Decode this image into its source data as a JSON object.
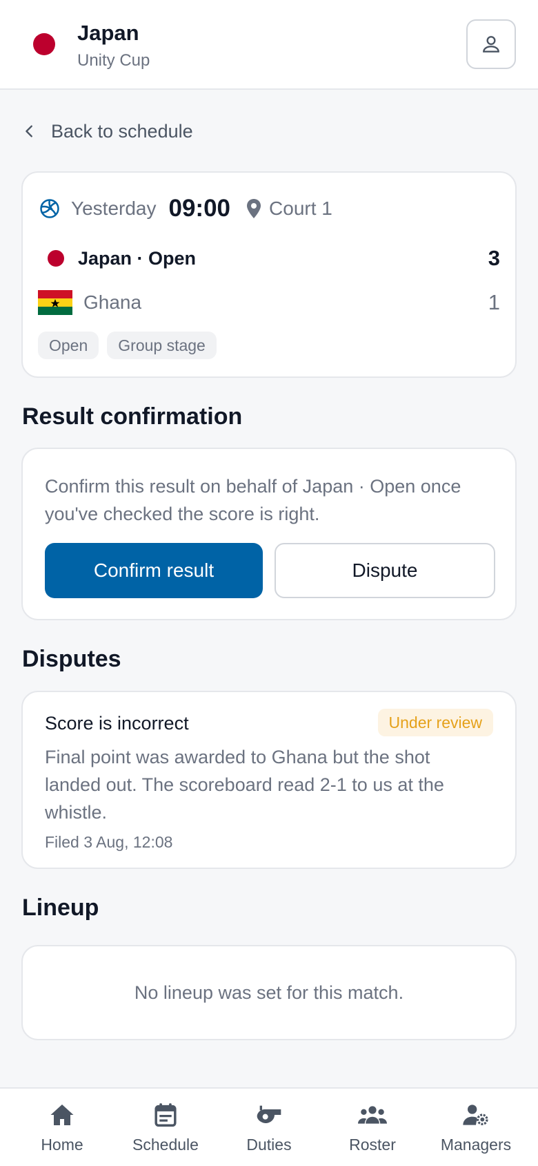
{
  "header": {
    "team_name": "Japan",
    "tournament": "Unity Cup",
    "team_color": "#bc002d"
  },
  "back_link": {
    "label": "Back to schedule"
  },
  "match": {
    "day": "Yesterday",
    "time": "09:00",
    "court": "Court 1",
    "home": {
      "name": "Japan · Open",
      "score": "3"
    },
    "away": {
      "name": "Ghana",
      "score": "1"
    },
    "tags": [
      "Open",
      "Group stage"
    ]
  },
  "result_confirmation": {
    "title": "Result confirmation",
    "text": "Confirm this result on behalf of Japan · Open once you've checked the score is right.",
    "confirm_label": "Confirm result",
    "dispute_label": "Dispute"
  },
  "disputes": {
    "title": "Disputes",
    "items": [
      {
        "title": "Score is incorrect",
        "status": "Under review",
        "body": "Final point was awarded to Ghana but the shot landed out. The scoreboard read 2-1 to us at the whistle.",
        "filed": "Filed 3 Aug, 12:08"
      }
    ]
  },
  "lineup": {
    "title": "Lineup",
    "empty_text": "No lineup was set for this match."
  },
  "nav": {
    "items": [
      {
        "label": "Home",
        "icon": "home-icon"
      },
      {
        "label": "Schedule",
        "icon": "calendar-icon"
      },
      {
        "label": "Duties",
        "icon": "whistle-icon"
      },
      {
        "label": "Roster",
        "icon": "group-icon"
      },
      {
        "label": "Managers",
        "icon": "user-gear-icon"
      }
    ]
  },
  "colors": {
    "primary": "#0063a6",
    "badge_text": "#e5a11a",
    "badge_bg": "#fdf3e2",
    "japan_red": "#bc002d"
  }
}
